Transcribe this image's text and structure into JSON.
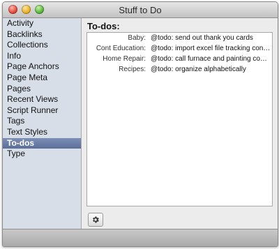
{
  "window": {
    "title": "Stuff to Do"
  },
  "sidebar": {
    "items": [
      {
        "label": "Activity"
      },
      {
        "label": "Backlinks"
      },
      {
        "label": "Collections"
      },
      {
        "label": "Info"
      },
      {
        "label": "Page Anchors"
      },
      {
        "label": "Page Meta"
      },
      {
        "label": "Pages"
      },
      {
        "label": "Recent Views"
      },
      {
        "label": "Script Runner"
      },
      {
        "label": "Tags"
      },
      {
        "label": "Text Styles"
      },
      {
        "label": "To-dos",
        "selected": true
      },
      {
        "label": "Type"
      }
    ]
  },
  "main": {
    "title": "To-dos:",
    "rows": [
      {
        "category": "Baby:",
        "item": "@todo: send out thank you cards"
      },
      {
        "category": "Cont Education:",
        "item": "@todo: import excel file tracking cont. ed"
      },
      {
        "category": "Home Repair:",
        "item": "@todo: call furnace and painting comp..."
      },
      {
        "category": "Recipes:",
        "item": "@todo: organize alphabetically"
      }
    ],
    "action_icon": "gear-icon"
  }
}
